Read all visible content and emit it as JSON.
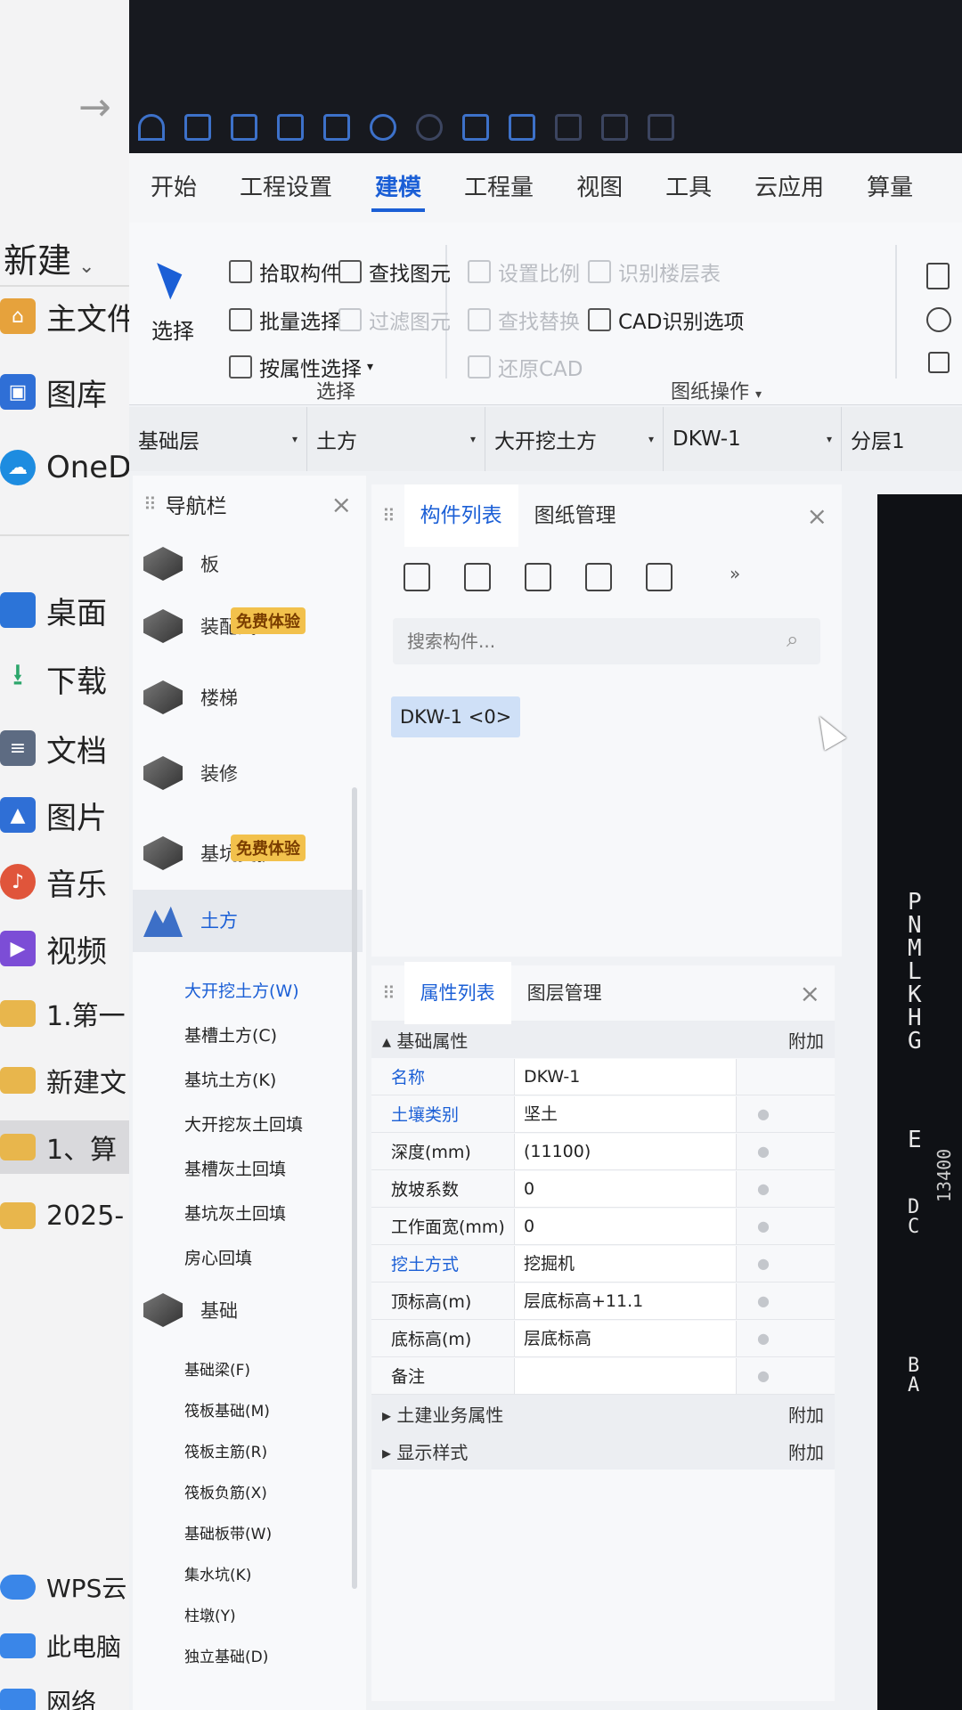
{
  "explorer": {
    "new_label": "新建",
    "items": [
      {
        "label": "主文件",
        "color": "#e6a23c"
      },
      {
        "label": "图库",
        "color": "#2f6fd6"
      },
      {
        "label": "OneD",
        "color": "#1d8ce0"
      },
      {
        "label": "桌面",
        "color": "#2c74d8"
      },
      {
        "label": "下载",
        "color": "#2ca66b"
      },
      {
        "label": "文档",
        "color": "#5d6b82"
      },
      {
        "label": "图片",
        "color": "#2f6fd6"
      },
      {
        "label": "音乐",
        "color": "#e0553b"
      },
      {
        "label": "视频",
        "color": "#7c4dd6"
      },
      {
        "label": "1.第一",
        "color": "#e8b64c"
      },
      {
        "label": "新建文",
        "color": "#e8b64c"
      },
      {
        "label": "1、算",
        "color": "#e8b64c"
      },
      {
        "label": "2025-",
        "color": "#e8b64c"
      },
      {
        "label": "WPS云",
        "color": "#3a86e8"
      },
      {
        "label": "此电脑",
        "color": "#3a86e8"
      },
      {
        "label": "网络",
        "color": "#3a86e8"
      }
    ]
  },
  "menu": {
    "tabs": [
      "开始",
      "工程设置",
      "建模",
      "工程量",
      "视图",
      "工具",
      "云应用",
      "算量"
    ]
  },
  "ribbon": {
    "select_big": "选择",
    "pick": "拾取构件",
    "batch": "批量选择",
    "by_attr": "按属性选择",
    "group_select": "选择",
    "find_elem": "查找图元",
    "filter_elem": "过滤图元",
    "set_scale": "设置比例",
    "recognize_floor": "识别楼层表",
    "find_replace": "查找替换",
    "cad_options": "CAD识别选项",
    "restore_cad": "还原CAD",
    "group_drawing": "图纸操作"
  },
  "selectors": [
    "基础层",
    "土方",
    "大开挖土方",
    "DKW-1",
    "分层1"
  ],
  "nav": {
    "title": "导航栏",
    "cats": [
      {
        "label": "板"
      },
      {
        "label": "装配式"
      },
      {
        "label": "楼梯"
      },
      {
        "label": "装修"
      },
      {
        "label": "基坑支护"
      },
      {
        "label": "土方"
      },
      {
        "label": "基础"
      }
    ],
    "badge": "免费体验",
    "earth_subs": [
      "大开挖土方(W)",
      "基槽土方(C)",
      "基坑土方(K)",
      "大开挖灰土回填",
      "基槽灰土回填",
      "基坑灰土回填",
      "房心回填"
    ],
    "found_subs": [
      "基础梁(F)",
      "筏板基础(M)",
      "筏板主筋(R)",
      "筏板负筋(X)",
      "基础板带(W)",
      "集水坑(K)",
      "柱墩(Y)",
      "独立基础(D)"
    ]
  },
  "components": {
    "tab_active": "构件列表",
    "tab_other": "图纸管理",
    "search_placeholder": "搜索构件...",
    "item": "DKW-1 <0>"
  },
  "properties": {
    "tab_active": "属性列表",
    "tab_other": "图层管理",
    "section_main": "基础属性",
    "attach": "附加",
    "rows": [
      {
        "name": "名称",
        "value": "DKW-1"
      },
      {
        "name": "土壤类别",
        "value": "坚土"
      },
      {
        "name": "深度(mm)",
        "value": "(11100)"
      },
      {
        "name": "放坡系数",
        "value": "0"
      },
      {
        "name": "工作面宽(mm)",
        "value": "0"
      },
      {
        "name": "挖土方式",
        "value": "挖掘机"
      },
      {
        "name": "顶标高(m)",
        "value": "层底标高+11.1"
      },
      {
        "name": "底标高(m)",
        "value": "层底标高"
      },
      {
        "name": "备注",
        "value": ""
      }
    ],
    "section_civil": "土建业务属性",
    "section_style": "显示样式"
  },
  "cad": {
    "axis_top": "P\nN\nM\nL\nK\nH\nG",
    "axis_e": "E",
    "axis_dc": "D\nC",
    "axis_ba": "B\nA",
    "dimension": "13400"
  }
}
